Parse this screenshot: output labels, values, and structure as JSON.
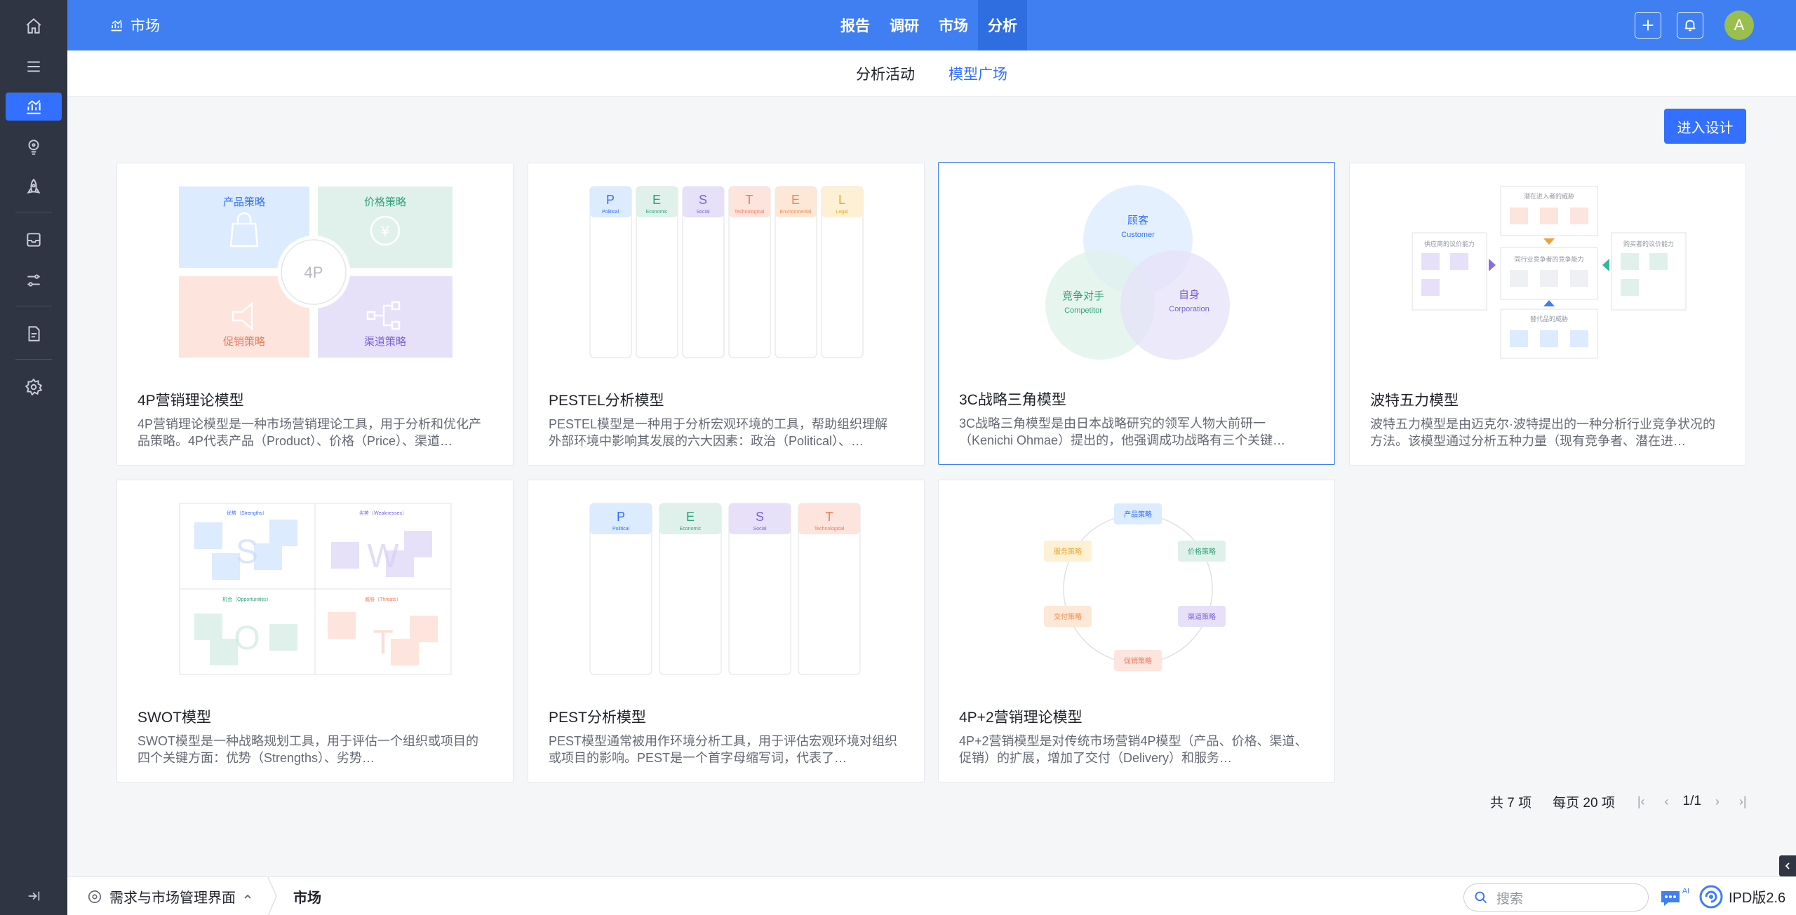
{
  "app": {
    "section_title": "市场"
  },
  "top_nav": {
    "items": [
      "报告",
      "调研",
      "市场",
      "分析"
    ],
    "active": "分析"
  },
  "sub_nav": {
    "tabs": [
      "分析活动",
      "模型广场"
    ],
    "active": "模型广场"
  },
  "enter_design_label": "进入设计",
  "user_initial": "A",
  "cards": [
    {
      "title": "4P营销理论模型",
      "description": "4P营销理论模型是一种市场营销理论工具，用于分析和优化产品策略。4P代表产品（Product）、价格（Price）、渠道…",
      "thumb": {
        "q1": "产品策略",
        "q2": "价格策略",
        "q3": "促销策略",
        "q4": "渠道策略",
        "center": "4P"
      }
    },
    {
      "title": "PESTEL分析模型",
      "description": "PESTEL模型是一种用于分析宏观环境的工具，帮助组织理解外部环境中影响其发展的六大因素：政治（Political）、…",
      "thumb": {
        "cols": [
          {
            "letter": "P",
            "sub": "Political"
          },
          {
            "letter": "E",
            "sub": "Economic"
          },
          {
            "letter": "S",
            "sub": "Social"
          },
          {
            "letter": "T",
            "sub": "Technological"
          },
          {
            "letter": "E",
            "sub": "Environmental"
          },
          {
            "letter": "L",
            "sub": "Legal"
          }
        ]
      }
    },
    {
      "title": "3C战略三角模型",
      "description": "3C战略三角模型是由日本战略研究的领军人物大前研一（Kenichi Ohmae）提出的，他强调成功战略有三个关键…",
      "thumb": {
        "c1": "顾客",
        "c1_en": "Customer",
        "c2": "竞争对手",
        "c2_en": "Competitor",
        "c3": "自身",
        "c3_en": "Corporation"
      }
    },
    {
      "title": "波特五力模型",
      "description": "波特五力模型是由迈克尔·波特提出的一种分析行业竞争状况的方法。该模型通过分析五种力量（现有竞争者、潜在进…",
      "thumb": {
        "top": "潜在进入者的威胁",
        "left": "供应商的议价能力",
        "center": "同行业竞争者的竞争能力",
        "right": "购买者的议价能力",
        "bottom": "替代品的威胁"
      }
    },
    {
      "title": "SWOT模型",
      "description": "SWOT模型是一种战略规划工具，用于评估一个组织或项目的四个关键方面：优势（Strengths）、劣势…",
      "thumb": {
        "s": "优势（Strengths）",
        "w": "劣势（Weaknesses）",
        "o": "机会（Opportunities）",
        "t": "威胁（Threats）",
        "ls": "S",
        "lw": "W",
        "lo": "O",
        "lt": "T"
      }
    },
    {
      "title": "PEST分析模型",
      "description": "PEST模型通常被用作环境分析工具，用于评估宏观环境对组织或项目的影响。PEST是一个首字母缩写词，代表了…",
      "thumb": {
        "cols": [
          {
            "letter": "P",
            "sub": "Political"
          },
          {
            "letter": "E",
            "sub": "Economic"
          },
          {
            "letter": "S",
            "sub": "Social"
          },
          {
            "letter": "T",
            "sub": "Technological"
          }
        ]
      }
    },
    {
      "title": "4P+2营销理论模型",
      "description": "4P+2营销模型是对传统市场营销4P模型（产品、价格、渠道、促销）的扩展，增加了交付（Delivery）和服务…",
      "thumb": {
        "n1": "产品策略",
        "n2": "价格策略",
        "n3": "渠道策略",
        "n4": "促销策略",
        "n5": "交付策略",
        "n6": "服务策略"
      }
    }
  ],
  "pagination": {
    "total": "共 7 项",
    "per_page": "每页 20 项",
    "page": "1/1"
  },
  "bottom_bar": {
    "crumb1": "需求与市场管理界面",
    "crumb2": "市场",
    "search_placeholder": "搜索",
    "version": "IPD版2.6",
    "ai_label": "AI"
  },
  "colors": {
    "primary": "#3370ff",
    "topbar": "#3f7ff2",
    "sidebar": "#2f3543"
  }
}
